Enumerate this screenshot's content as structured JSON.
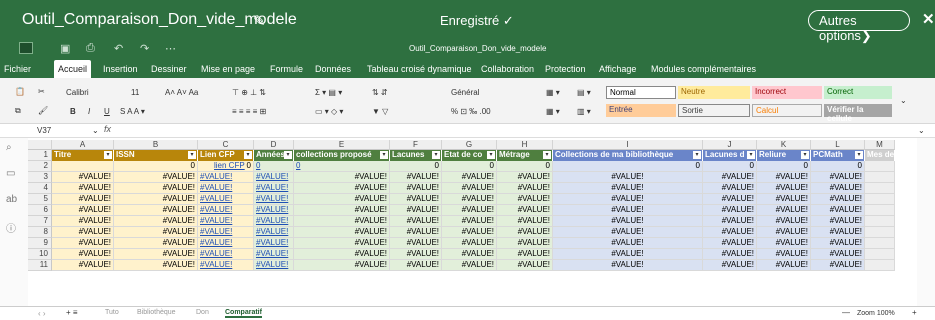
{
  "window": {
    "title": "Outil_Comparaison_Don_vide_modele",
    "status": "Enregistré ✓",
    "more_options": "Autres options❯",
    "subtitle": "Outil_Comparaison_Don_vide_modele"
  },
  "menu": [
    "Fichier",
    "Accueil",
    "Insertion",
    "Dessiner",
    "Mise en page",
    "Formule",
    "Données",
    "Tableau croisé dynamique",
    "Collaboration",
    "Protection",
    "Affichage",
    "Modules complémentaires"
  ],
  "ribbon": {
    "font": "Calibri",
    "size": "11",
    "number_format": "Général",
    "styles": [
      {
        "label": "Normal",
        "bg": "#ffffff",
        "fg": "#000000"
      },
      {
        "label": "Neutre",
        "bg": "#ffeb9c",
        "fg": "#9c6500"
      },
      {
        "label": "Incorrect",
        "bg": "#ffc7ce",
        "fg": "#9c0006"
      },
      {
        "label": "Correct",
        "bg": "#c6efce",
        "fg": "#006100"
      },
      {
        "label": "Entrée",
        "bg": "#ffcc99",
        "fg": "#3f3f76"
      },
      {
        "label": "Sortie",
        "bg": "#f2f2f2",
        "fg": "#3f3f3f"
      },
      {
        "label": "Calcul",
        "bg": "#f2f2f2",
        "fg": "#fa7d00"
      },
      {
        "label": "Vérifier la cellule",
        "bg": "#a5a5a5",
        "fg": "#ffffff"
      }
    ]
  },
  "namebox": "V37",
  "fx": "fx",
  "columns": [
    "A",
    "B",
    "C",
    "D",
    "E",
    "F",
    "G",
    "H",
    "I",
    "J",
    "K",
    "L",
    "M"
  ],
  "headers": [
    "Titre",
    "ISSN",
    "Lien CFP",
    "Années p",
    "collections proposé",
    "Lacunes",
    "Etat de co",
    "Métrage",
    "Collections de ma bibliothèque",
    "Lacunes d",
    "Reliure",
    "PCMath",
    "Mes de"
  ],
  "header_colors": [
    "#b8860b",
    "#b8860b",
    "#b8860b",
    "#4f7f3f",
    "#4f7f3f",
    "#4f7f3f",
    "#4f7f3f",
    "#4f7f3f",
    "#6a85c9",
    "#6a85c9",
    "#6a85c9",
    "#6a85c9",
    "#cfcfcf"
  ],
  "row2": [
    "",
    "0",
    "0",
    "0",
    "0",
    "0",
    "0",
    "0",
    "0",
    "0",
    "0",
    "0",
    ""
  ],
  "row2_link": "lien CFP",
  "rows": [
    "3",
    "4",
    "5",
    "6",
    "7",
    "8",
    "9",
    "10",
    "11"
  ],
  "value": "#VALUE!",
  "sheets": [
    "Tuto",
    "Bibliothèque",
    "Don",
    "Comparatif"
  ],
  "zoom": "Zoom 100%"
}
